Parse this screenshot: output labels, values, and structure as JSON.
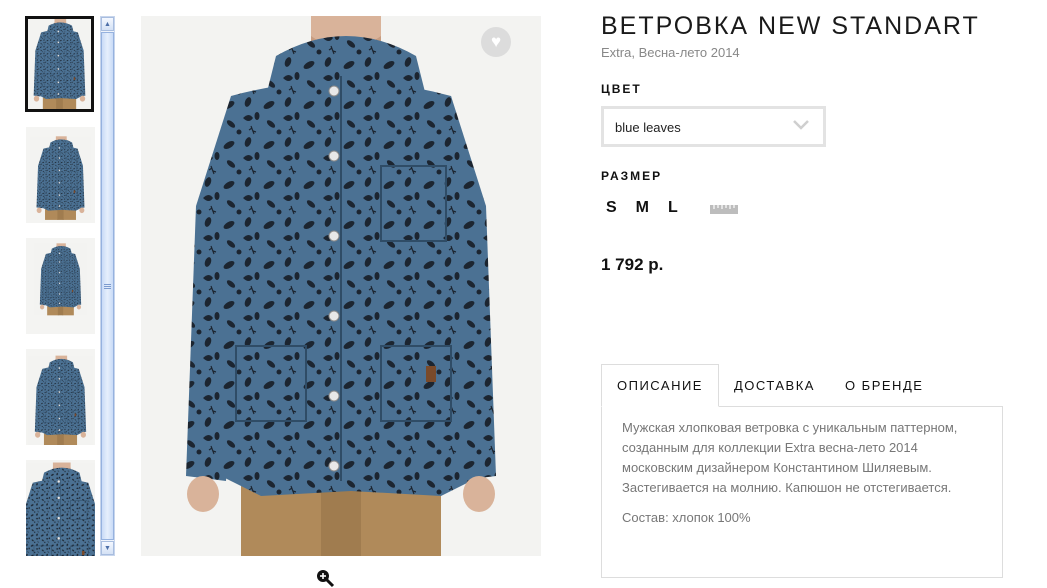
{
  "product": {
    "title": "ВЕТРОВКА NEW STANDART",
    "subtitle": "Extra, Весна-лето 2014",
    "color_label": "ЦВЕТ",
    "color_value": "blue leaves",
    "size_label": "РАЗМЕР",
    "sizes": [
      "S",
      "M",
      "L"
    ],
    "price": "1 792 р."
  },
  "gallery": {
    "thumbnail_count": 5,
    "selected_index": 0,
    "favorite_icon": "heart-icon",
    "zoom_icon": "zoom-in-icon"
  },
  "tabs": [
    {
      "label": "ОПИСАНИЕ",
      "active": true
    },
    {
      "label": "ДОСТАВКА",
      "active": false
    },
    {
      "label": "О БРЕНДЕ",
      "active": false
    }
  ],
  "description": {
    "text": "Мужская хлопковая ветровка с уникальным паттерном, созданным для коллекции Extra весна-лето 2014 московским дизайнером Константином Шиляевым. Застегивается на молнию. Капюшон не отстегивается.",
    "composition": "Состав: хлопок 100%"
  },
  "colors": {
    "jacket": "#4a6f8f",
    "leaves": "#1c2530",
    "pants": "#b08a5a",
    "border": "#e3e3e3"
  }
}
